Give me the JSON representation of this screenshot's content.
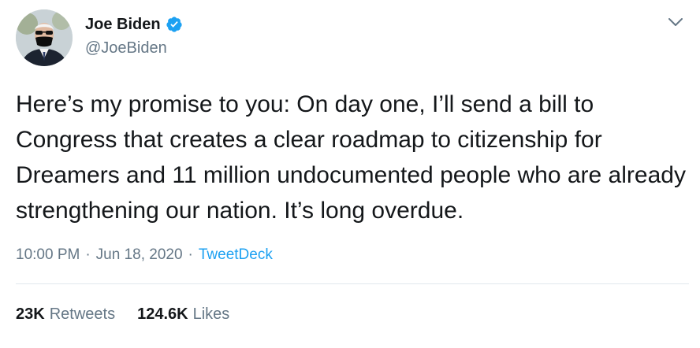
{
  "author": {
    "name": "Joe Biden",
    "handle": "@JoeBiden",
    "verified": true
  },
  "tweet": {
    "text": "Here’s my promise to you: On day one, I’ll send a bill to Congress that creates a clear roadmap to citizenship for Dreamers and 11 million undocumented people who are already strengthening our nation. It’s long overdue."
  },
  "meta": {
    "time": "10:00 PM",
    "separator": "·",
    "date": "Jun 18, 2020",
    "source": "TweetDeck"
  },
  "stats": {
    "retweets_count": "23K",
    "retweets_label": "Retweets",
    "likes_count": "124.6K",
    "likes_label": "Likes"
  },
  "colors": {
    "accent": "#1da1f2",
    "secondary_text": "#657786",
    "divider": "#e1e8ed"
  },
  "icons": {
    "verified": "verified-badge-icon",
    "menu": "chevron-down-icon"
  }
}
